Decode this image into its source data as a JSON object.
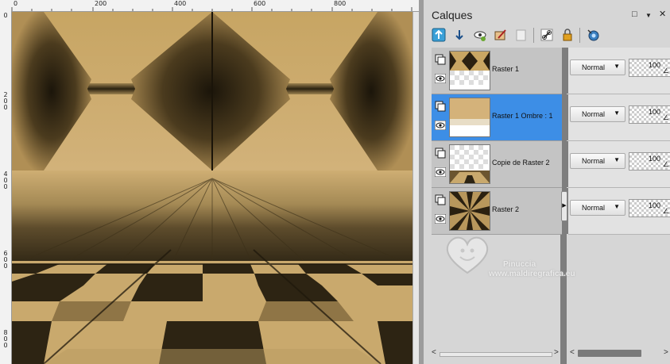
{
  "ruler": {
    "top_labels": [
      "0",
      "200",
      "400",
      "600",
      "800"
    ],
    "left_labels": [
      [
        "0"
      ],
      [
        "2",
        "0",
        "0"
      ],
      [
        "4",
        "0",
        "0"
      ],
      [
        "6",
        "0",
        "0"
      ],
      [
        "8",
        "0",
        "0"
      ]
    ]
  },
  "palette": {
    "title": "Calques",
    "toolbar_icons": [
      "new-layer-above-icon",
      "new-layer-below-icon",
      "new-adjustment-layer-icon",
      "new-mask-icon",
      "delete-layer-icon",
      "link-icon",
      "lock-icon",
      "layer-style-icon"
    ]
  },
  "layers": [
    {
      "name": "Raster 1",
      "blend": "Normal",
      "opacity": "100",
      "selected": false
    },
    {
      "name": "Raster 1 Ombre : 1",
      "blend": "Normal",
      "opacity": "100",
      "selected": true
    },
    {
      "name": "Copie de Raster 2",
      "blend": "Normal",
      "opacity": "100",
      "selected": false
    },
    {
      "name": "Raster 2",
      "blend": "Normal",
      "opacity": "100",
      "selected": false
    }
  ],
  "watermark": {
    "name": "Pinuccia",
    "url": "www.maldiregrafica.eu"
  },
  "colors": {
    "selection": "#3d8ee6",
    "gold_light": "#d4b27a",
    "gold_dark": "#2a2112"
  }
}
